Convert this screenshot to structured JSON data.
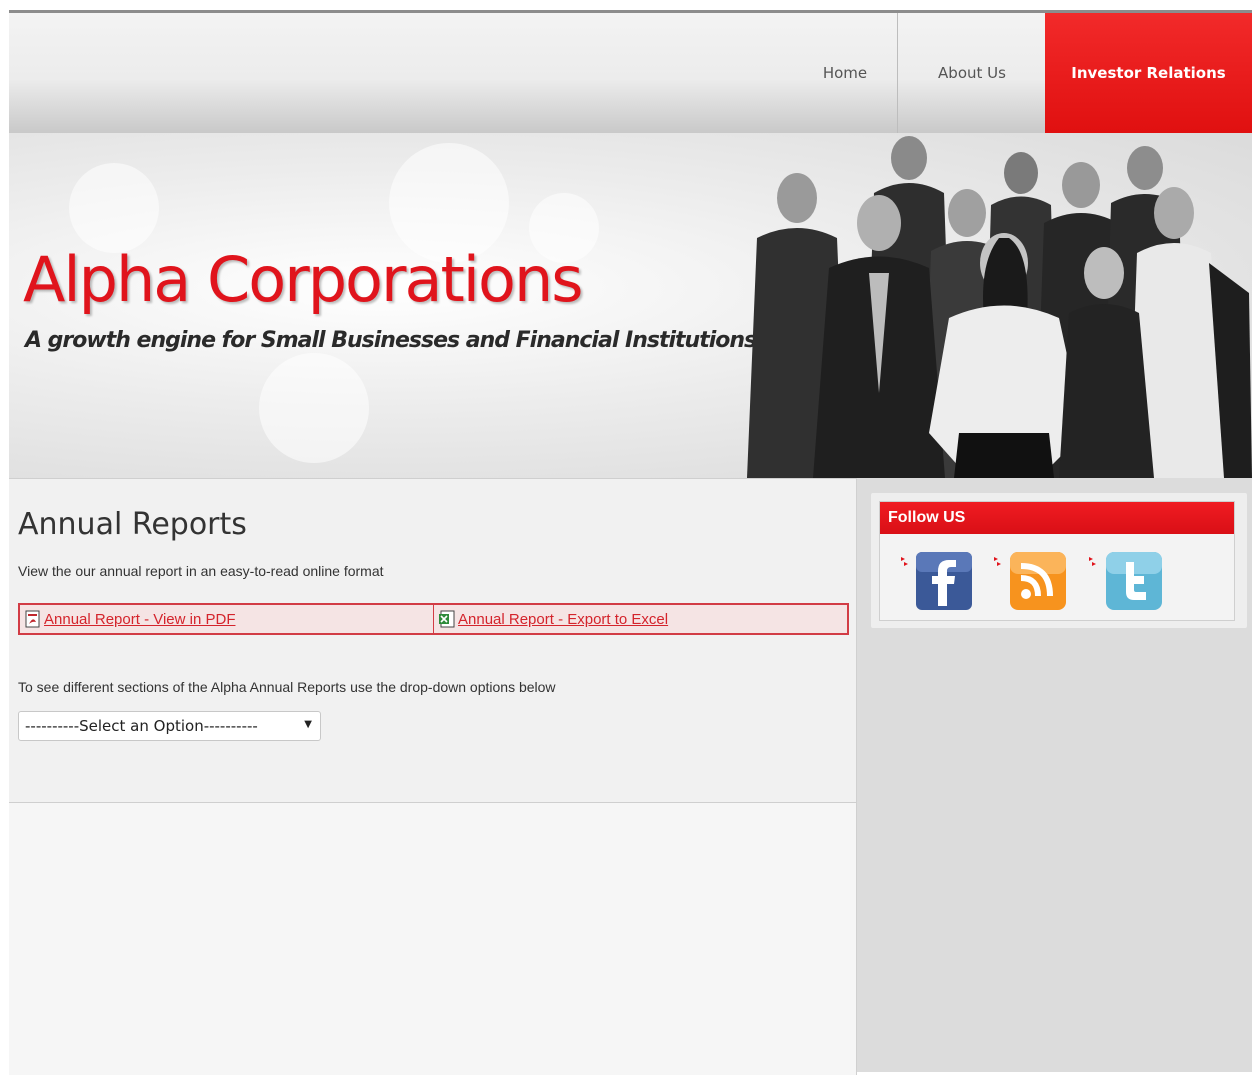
{
  "nav": {
    "items": [
      {
        "label": "Home",
        "active": false
      },
      {
        "label": "About Us",
        "active": false
      },
      {
        "label": "Investor Relations",
        "active": true
      }
    ]
  },
  "banner": {
    "brand": "Alpha Corporations",
    "tagline": "A growth engine for Small Businesses and Financial Institutions"
  },
  "main": {
    "heading": "Annual Reports",
    "description": "View the our annual report in an easy-to-read online format",
    "links": [
      {
        "label": "Annual Report - View in PDF",
        "icon": "pdf-icon"
      },
      {
        "label": "Annual Report - Export to Excel",
        "icon": "excel-icon"
      }
    ],
    "select_hint": "To see different sections of the Alpha Annual Reports use the drop-down options below",
    "dropdown": {
      "selected": "----------Select an Option----------"
    }
  },
  "sidebar": {
    "follow_title": "Follow US",
    "social": [
      {
        "name": "facebook-icon",
        "color": "#3b5998"
      },
      {
        "name": "rss-icon",
        "color": "#f7931e"
      },
      {
        "name": "twitter-icon",
        "color": "#5eb6d6"
      }
    ]
  },
  "colors": {
    "accent": "#e0141c",
    "link": "#d4242c"
  }
}
